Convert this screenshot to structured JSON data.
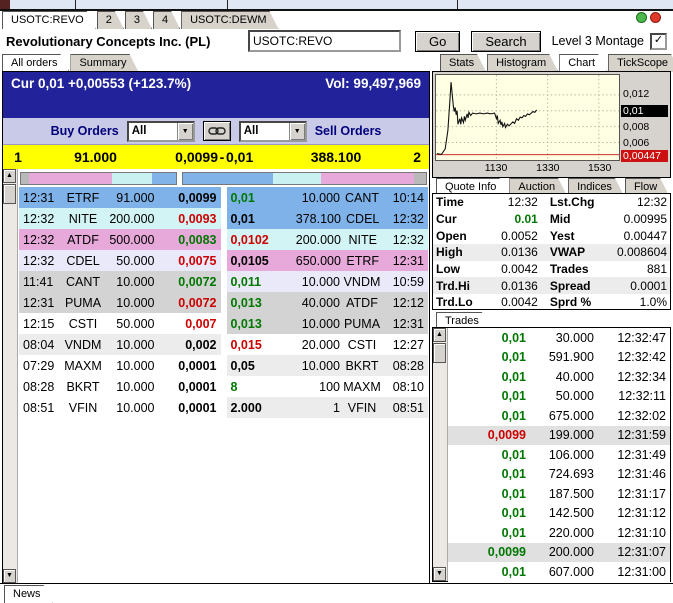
{
  "icons": {
    "dropdown_arrow": "▼",
    "scroll_up": "▲",
    "scroll_down": "▼",
    "checkbox_check": "✓"
  },
  "top_tabs": [
    {
      "label": "USOTC:REVO",
      "active": true
    },
    {
      "label": "2",
      "active": false
    },
    {
      "label": "3",
      "active": false
    },
    {
      "label": "4",
      "active": false
    },
    {
      "label": "USOTC:DEWM",
      "active": false
    }
  ],
  "header": {
    "title": "Revolutionary Concepts Inc. (PL)",
    "symbol_value": "USOTC:REVO",
    "go_label": "Go",
    "search_label": "Search",
    "level3_label": "Level 3 Montage",
    "level3_checked": true
  },
  "montage": {
    "tabs": [
      {
        "label": "All orders",
        "active": true
      },
      {
        "label": "Summary",
        "active": false
      }
    ],
    "cur_line": "Cur 0,01 +0,00553 (+123.7%)",
    "vol_line": "Vol: 99,497,969",
    "buy_orders_label": "Buy Orders",
    "sell_orders_label": "Sell Orders",
    "buy_filter": "All",
    "sell_filter": "All",
    "bbo": {
      "bid_count": "1",
      "bid_size": "91.000",
      "bid_price": "0,0099",
      "sep": "-",
      "ask_price": "0,01",
      "ask_size": "388.100",
      "ask_count": "2"
    },
    "depth_left_segments": [
      {
        "color": "#b9b9b9",
        "pct": 5
      },
      {
        "color": "#e6a9d9",
        "pct": 54
      },
      {
        "color": "#c9f1f1",
        "pct": 26
      },
      {
        "color": "#82b3e8",
        "pct": 15
      }
    ],
    "depth_right_segments": [
      {
        "color": "#82b3e8",
        "pct": 37
      },
      {
        "color": "#c9f1f1",
        "pct": 20
      },
      {
        "color": "#e6a9d9",
        "pct": 38
      },
      {
        "color": "#b9b9b9",
        "pct": 5
      }
    ],
    "buy_rows": [
      {
        "time": "12:31",
        "mm": "ETRF",
        "size": "91.000",
        "price": "0,0099",
        "pc": "#000000",
        "bg": "#7fb2e8"
      },
      {
        "time": "12:32",
        "mm": "NITE",
        "size": "200.000",
        "price": "0,0093",
        "pc": "#cc0000",
        "bg": "#d2f4f4"
      },
      {
        "time": "12:32",
        "mm": "ATDF",
        "size": "500.000",
        "price": "0,0083",
        "pc": "#007700",
        "bg": "#e6a9d9"
      },
      {
        "time": "12:32",
        "mm": "CDEL",
        "size": "50.000",
        "price": "0,0075",
        "pc": "#cc0000",
        "bg": "#e9e9fa"
      },
      {
        "time": "11:41",
        "mm": "CANT",
        "size": "10.000",
        "price": "0,0072",
        "pc": "#007700",
        "bg": "#d3d3d3"
      },
      {
        "time": "12:31",
        "mm": "PUMA",
        "size": "10.000",
        "price": "0,0072",
        "pc": "#cc0000",
        "bg": "#d3d3d3"
      },
      {
        "time": "12:15",
        "mm": "CSTI",
        "size": "50.000",
        "price": "0,007",
        "pc": "#cc0000",
        "bg": "#ffffff"
      },
      {
        "time": "08:04",
        "mm": "VNDM",
        "size": "10.000",
        "price": "0,002",
        "pc": "#000000",
        "bg": "#ececec"
      },
      {
        "time": "07:29",
        "mm": "MAXM",
        "size": "10.000",
        "price": "0,0001",
        "pc": "#000000",
        "bg": "#ffffff"
      },
      {
        "time": "08:28",
        "mm": "BKRT",
        "size": "10.000",
        "price": "0,0001",
        "pc": "#000000",
        "bg": "#ffffff"
      },
      {
        "time": "08:51",
        "mm": "VFIN",
        "size": "10.000",
        "price": "0,0001",
        "pc": "#000000",
        "bg": "#ffffff"
      }
    ],
    "sell_rows": [
      {
        "price": "0,01",
        "size": "10.000",
        "mm": "CANT",
        "time": "10:14",
        "pc": "#007700",
        "bg": "#7fb2e8"
      },
      {
        "price": "0,01",
        "size": "378.100",
        "mm": "CDEL",
        "time": "12:32",
        "pc": "#000000",
        "bg": "#7fb2e8"
      },
      {
        "price": "0,0102",
        "size": "200.000",
        "mm": "NITE",
        "time": "12:32",
        "pc": "#cc0000",
        "bg": "#d2f4f4"
      },
      {
        "price": "0,0105",
        "size": "650.000",
        "mm": "ETRF",
        "time": "12:31",
        "pc": "#000000",
        "bg": "#e6a9d9"
      },
      {
        "price": "0,011",
        "size": "10.000",
        "mm": "VNDM",
        "time": "10:59",
        "pc": "#007700",
        "bg": "#e9e9fa"
      },
      {
        "price": "0,013",
        "size": "40.000",
        "mm": "ATDF",
        "time": "12:12",
        "pc": "#007700",
        "bg": "#d3d3d3"
      },
      {
        "price": "0,013",
        "size": "10.000",
        "mm": "PUMA",
        "time": "12:31",
        "pc": "#007700",
        "bg": "#d3d3d3"
      },
      {
        "price": "0,015",
        "size": "20.000",
        "mm": "CSTI",
        "time": "12:27",
        "pc": "#cc0000",
        "bg": "#ffffff"
      },
      {
        "price": "0,05",
        "size": "10.000",
        "mm": "BKRT",
        "time": "08:28",
        "pc": "#000000",
        "bg": "#ececec"
      },
      {
        "price": "8",
        "size": "100",
        "mm": "MAXM",
        "time": "08:10",
        "pc": "#007700",
        "bg": "#ffffff"
      },
      {
        "price": "2.000",
        "size": "1",
        "mm": "VFIN",
        "time": "08:51",
        "pc": "#000000",
        "bg": "#ececec"
      }
    ]
  },
  "right": {
    "chart_tabs": [
      {
        "label": "Stats",
        "active": false
      },
      {
        "label": "Histogram",
        "active": false
      },
      {
        "label": "Chart",
        "active": true
      },
      {
        "label": "TickScope",
        "active": false
      }
    ],
    "quote_tabs": [
      {
        "label": "Quote Info",
        "active": true
      },
      {
        "label": "Auction",
        "active": false
      },
      {
        "label": "Indices",
        "active": false
      },
      {
        "label": "Flow",
        "active": false
      }
    ],
    "quote_rows": [
      {
        "l1": "Time",
        "v1": "12:32",
        "v1c": "#000000",
        "l2": "Lst.Chg",
        "v2": "12:32",
        "bg": "#ffffff"
      },
      {
        "l1": "Cur",
        "v1": "0.01",
        "v1c": "#007700",
        "l2": "Mid",
        "v2": "0.00995",
        "bg": "#ffffff"
      },
      {
        "l1": "Open",
        "v1": "0.0052",
        "v1c": "#000000",
        "l2": "Yest",
        "v2": "0.00447",
        "bg": "#ffffff"
      },
      {
        "l1": "High",
        "v1": "0.0136",
        "v1c": "#000000",
        "l2": "VWAP",
        "v2": "0.008604",
        "bg": "#ececec"
      },
      {
        "l1": "Low",
        "v1": "0.0042",
        "v1c": "#000000",
        "l2": "Trades",
        "v2": "881",
        "bg": "#ffffff"
      },
      {
        "l1": "Trd.Hi",
        "v1": "0.0136",
        "v1c": "#000000",
        "l2": "Spread",
        "v2": "0.0001",
        "bg": "#ececec"
      },
      {
        "l1": "Trd.Lo",
        "v1": "0.0042",
        "v1c": "#000000",
        "l2": "Sprd %",
        "v2": "1.0%",
        "bg": "#ffffff"
      }
    ],
    "trades_tab": "Trades",
    "trades": [
      {
        "price": "0,01",
        "size": "30.000",
        "time": "12:32:47",
        "pc": "#007700",
        "bg": "#ffffff"
      },
      {
        "price": "0,01",
        "size": "591.900",
        "time": "12:32:42",
        "pc": "#007700",
        "bg": "#ffffff"
      },
      {
        "price": "0,01",
        "size": "40.000",
        "time": "12:32:34",
        "pc": "#007700",
        "bg": "#ffffff"
      },
      {
        "price": "0,01",
        "size": "50.000",
        "time": "12:32:11",
        "pc": "#007700",
        "bg": "#ffffff"
      },
      {
        "price": "0,01",
        "size": "675.000",
        "time": "12:32:02",
        "pc": "#007700",
        "bg": "#ffffff"
      },
      {
        "price": "0,0099",
        "size": "199.000",
        "time": "12:31:59",
        "pc": "#cc0000",
        "bg": "#e0e0e0"
      },
      {
        "price": "0,01",
        "size": "106.000",
        "time": "12:31:49",
        "pc": "#007700",
        "bg": "#ffffff"
      },
      {
        "price": "0,01",
        "size": "724.693",
        "time": "12:31:46",
        "pc": "#007700",
        "bg": "#ffffff"
      },
      {
        "price": "0,01",
        "size": "187.500",
        "time": "12:31:17",
        "pc": "#007700",
        "bg": "#ffffff"
      },
      {
        "price": "0,01",
        "size": "142.500",
        "time": "12:31:12",
        "pc": "#007700",
        "bg": "#ffffff"
      },
      {
        "price": "0,01",
        "size": "220.000",
        "time": "12:31:10",
        "pc": "#007700",
        "bg": "#ffffff"
      },
      {
        "price": "0,0099",
        "size": "200.000",
        "time": "12:31:07",
        "pc": "#007700",
        "bg": "#e0e0e0"
      },
      {
        "price": "0,01",
        "size": "607.000",
        "time": "12:31:00",
        "pc": "#007700",
        "bg": "#ffffff"
      }
    ]
  },
  "chart_data": {
    "type": "line",
    "title": "Intraday price",
    "x_ticks": [
      "1130",
      "1330",
      "1530"
    ],
    "x_tick_fractions": [
      0.33,
      0.61,
      0.89
    ],
    "y_ticks": [
      {
        "label": "0,012",
        "value": 0.012,
        "style": "plain"
      },
      {
        "label": "0,01",
        "value": 0.01,
        "style": "black"
      },
      {
        "label": "0,008",
        "value": 0.008,
        "style": "plain"
      },
      {
        "label": "0,006",
        "value": 0.006,
        "style": "plain"
      },
      {
        "label": "0,00447",
        "value": 0.00447,
        "style": "red"
      }
    ],
    "y_range": [
      0.0038,
      0.0145
    ],
    "ref_line_value": 0.00447,
    "line_color": "#111111",
    "ref_line_color": "#cc1111",
    "grid_color": "#b9b9a0",
    "bg": "#ffffe4",
    "points": [
      [
        0.005,
        0.0046
      ],
      [
        0.03,
        0.0045
      ],
      [
        0.05,
        0.0052
      ],
      [
        0.065,
        0.0075
      ],
      [
        0.075,
        0.011
      ],
      [
        0.082,
        0.0136
      ],
      [
        0.09,
        0.0118
      ],
      [
        0.095,
        0.0105
      ],
      [
        0.1,
        0.0099
      ],
      [
        0.105,
        0.0104
      ],
      [
        0.11,
        0.0095
      ],
      [
        0.115,
        0.01
      ],
      [
        0.12,
        0.0083
      ],
      [
        0.13,
        0.009
      ],
      [
        0.135,
        0.0083
      ],
      [
        0.14,
        0.0091
      ],
      [
        0.15,
        0.0085
      ],
      [
        0.155,
        0.0093
      ],
      [
        0.16,
        0.0088
      ],
      [
        0.17,
        0.0096
      ],
      [
        0.175,
        0.0091
      ],
      [
        0.18,
        0.0098
      ],
      [
        0.19,
        0.0094
      ],
      [
        0.2,
        0.0097
      ],
      [
        0.22,
        0.0096
      ],
      [
        0.24,
        0.0097
      ],
      [
        0.26,
        0.0096
      ],
      [
        0.28,
        0.0097
      ],
      [
        0.3,
        0.0096
      ],
      [
        0.32,
        0.0097
      ],
      [
        0.33,
        0.009
      ],
      [
        0.335,
        0.0094
      ],
      [
        0.34,
        0.0084
      ],
      [
        0.35,
        0.0088
      ],
      [
        0.355,
        0.0082
      ],
      [
        0.36,
        0.0086
      ],
      [
        0.365,
        0.008
      ],
      [
        0.375,
        0.0084
      ],
      [
        0.38,
        0.0079
      ],
      [
        0.39,
        0.0083
      ],
      [
        0.4,
        0.0081
      ],
      [
        0.42,
        0.0086
      ],
      [
        0.43,
        0.0084
      ],
      [
        0.44,
        0.009
      ],
      [
        0.45,
        0.0088
      ],
      [
        0.46,
        0.0092
      ],
      [
        0.47,
        0.0091
      ],
      [
        0.48,
        0.0094
      ],
      [
        0.49,
        0.0093
      ],
      [
        0.5,
        0.0096
      ],
      [
        0.51,
        0.0095
      ],
      [
        0.52,
        0.0097
      ],
      [
        0.53,
        0.0099
      ],
      [
        0.54,
        0.0098
      ],
      [
        0.55,
        0.0101
      ]
    ]
  },
  "news_tab": "News"
}
